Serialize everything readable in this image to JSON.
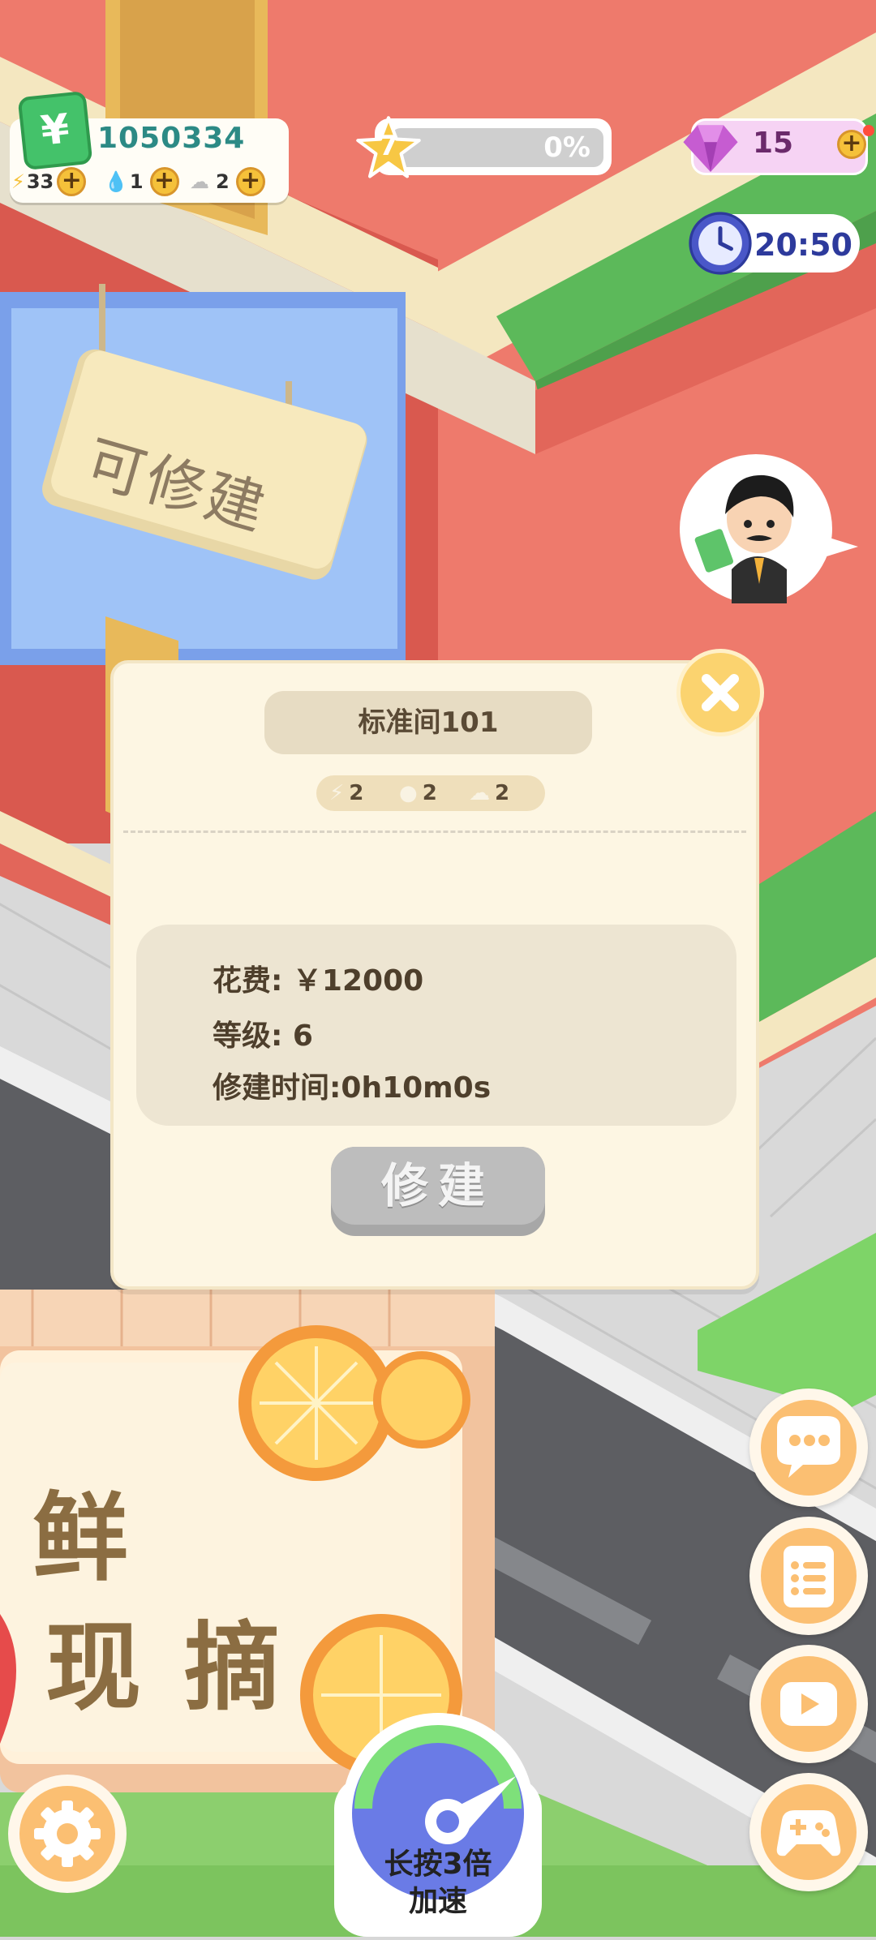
{
  "hud": {
    "money": "1050334",
    "money_icon": "yuan-banknote-icon",
    "resources": [
      {
        "name": "energy",
        "icon": "lightning-icon",
        "value": "33"
      },
      {
        "name": "water",
        "icon": "water-drop-icon",
        "value": "1"
      },
      {
        "name": "cloud",
        "icon": "cloud-icon",
        "value": "2"
      }
    ],
    "level": "7",
    "xp_percent_label": "0%",
    "xp_fraction": 0,
    "gems": "15",
    "timer": "20:50"
  },
  "building": {
    "sign_text": "可修建",
    "shop_sign_line1": "鲜",
    "shop_sign_line2": "现 摘"
  },
  "dialog": {
    "title": "标准间101",
    "stats": [
      {
        "icon": "lightning-icon",
        "value": "2"
      },
      {
        "icon": "water-drop-icon",
        "value": "2"
      },
      {
        "icon": "cloud-icon",
        "value": "2"
      }
    ],
    "cost_line": "花费:   ￥12000",
    "level_line": "等级:   6",
    "time_line": "修建时间:0h10m0s",
    "build_button": "修建"
  },
  "speed_button": {
    "line1": "长按3倍",
    "line2": "加速"
  },
  "colors": {
    "wall_red": "#ee7a6c",
    "dialog_bg": "#fdf6e3",
    "button_orange": "#fbbf72",
    "money_green": "#2c8a85",
    "accent_yellow": "#f5c13a"
  }
}
